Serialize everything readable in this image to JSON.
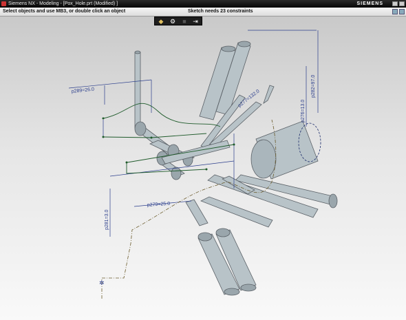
{
  "window": {
    "title": "Siemens NX - Modeling - [Pox_Hole.prt (Modified) ]",
    "brand": "SIEMENS"
  },
  "status": {
    "cue": "Select objects and use MB3, or double click an object",
    "message": "Sketch needs 23 constraints"
  },
  "toolbar": {
    "items": [
      "finish-sketch-icon",
      "settings-gear-icon",
      "blank-icon",
      "exit-sketch-icon"
    ]
  },
  "dimensions": {
    "p289": "p289=26.0",
    "p282": "p282=97.0",
    "p277": "p277=132.0",
    "p276": "p276=13.0",
    "p279": "p279=25.0",
    "p281": "p281=3.0"
  },
  "colors": {
    "dimension": "#2a3d8c",
    "sketch": "#1e5a2a",
    "construction": "#6a5a2a",
    "tube_fill": "#b8c3c8",
    "tube_stroke": "#5a6066"
  }
}
